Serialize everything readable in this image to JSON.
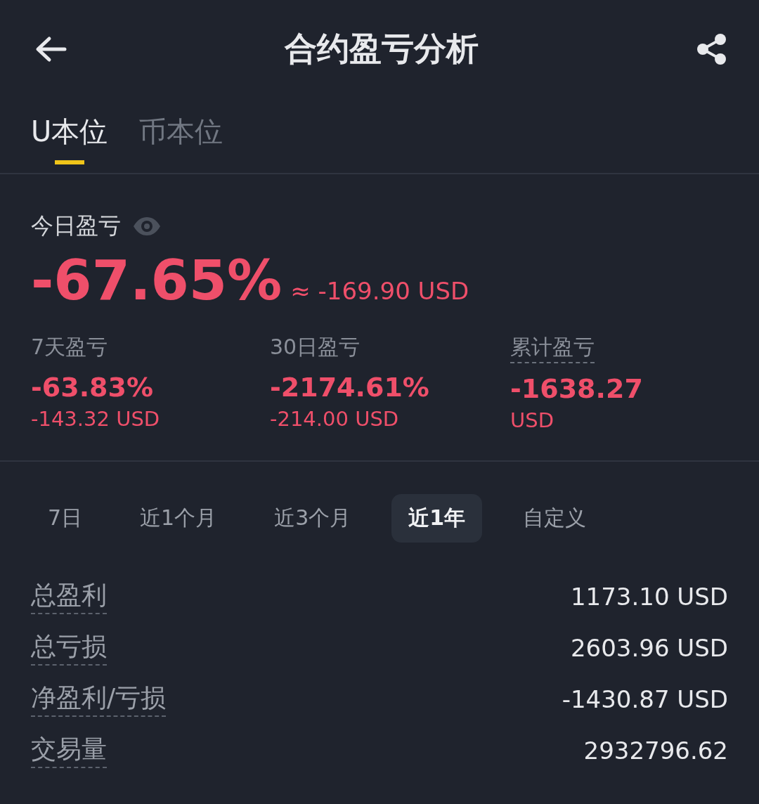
{
  "header": {
    "title": "合约盈亏分析"
  },
  "tabs": [
    {
      "label": "U本位",
      "selected": true
    },
    {
      "label": "币本位",
      "selected": false
    }
  ],
  "today": {
    "label": "今日盈亏",
    "percent": "-67.65%",
    "approx": "≈ -169.90 USD"
  },
  "summary": [
    {
      "label": "7天盈亏",
      "value": "-63.83%",
      "sub": "-143.32 USD",
      "dotted": false
    },
    {
      "label": "30日盈亏",
      "value": "-2174.61%",
      "sub": "-214.00 USD",
      "dotted": false
    },
    {
      "label": "累计盈亏",
      "value": "-1638.27",
      "sub": "USD",
      "dotted": true
    }
  ],
  "periods": [
    {
      "label": "7日",
      "selected": false
    },
    {
      "label": "近1个月",
      "selected": false
    },
    {
      "label": "近3个月",
      "selected": false
    },
    {
      "label": "近1年",
      "selected": true
    },
    {
      "label": "自定义",
      "selected": false
    }
  ],
  "stats": [
    {
      "label": "总盈利",
      "value": "1173.10 USD"
    },
    {
      "label": "总亏损",
      "value": "2603.96 USD"
    },
    {
      "label": "净盈利/亏损",
      "value": "-1430.87 USD"
    },
    {
      "label": "交易量",
      "value": "2932796.62"
    }
  ]
}
